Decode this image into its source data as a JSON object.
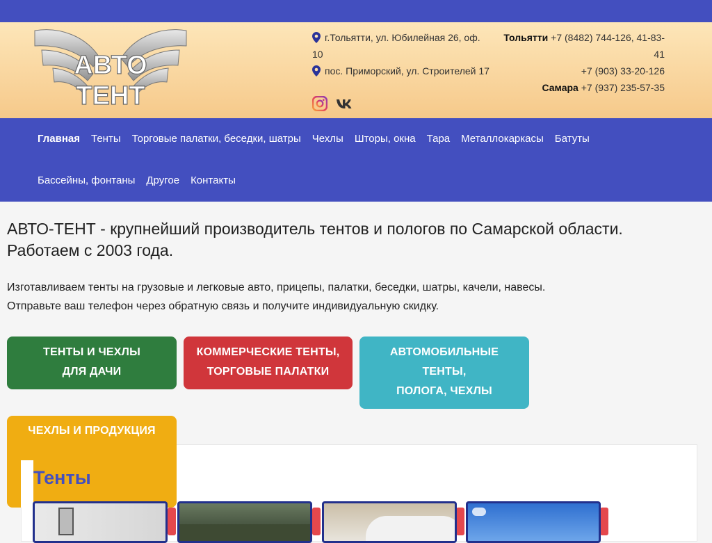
{
  "header": {
    "logo_text_top": "АВТО",
    "logo_text_bottom": "ТЕНТ",
    "address1": "г.Тольятти, ул. Юбилейная 26, оф. 10",
    "address2": "пос. Приморский, ул. Строителей 17",
    "phones": {
      "city1": "Тольятти",
      "city1_phone": "+7 (8482) 744-126, 41-83-41",
      "phone2": "+7 (903) 33-20-126",
      "city2": "Самара",
      "city2_phone": "+7 (937) 235-57-35"
    },
    "social": [
      "instagram-icon",
      "vk-icon"
    ]
  },
  "nav": {
    "items": [
      {
        "label": "Главная"
      },
      {
        "label": "Тенты"
      },
      {
        "label": "Торговые палатки, беседки, шатры"
      },
      {
        "label": "Чехлы"
      },
      {
        "label": "Шторы, окна"
      },
      {
        "label": "Тара"
      },
      {
        "label": "Металлокаркасы"
      },
      {
        "label": "Батуты"
      },
      {
        "label": "Бассейны, фонтаны"
      },
      {
        "label": "Другое"
      },
      {
        "label": "Контакты"
      }
    ]
  },
  "main": {
    "headline1": "АВТО-ТЕНТ - крупнейший производитель тентов и пологов по Самарской области.",
    "headline2": "Работаем с 2003 года.",
    "intro1": "Изготавливаем тенты на грузовые и легковые авто, прицепы, палатки, беседки, шатры, качели, навесы.",
    "intro2": "Отправьте ваш телефон через обратную связь и получите индивидуальную скидку.",
    "buttons": [
      {
        "line1": "ТЕНТЫ И ЧЕХЛЫ",
        "line2": "ДЛЯ ДАЧИ",
        "color": "#2f7d3e"
      },
      {
        "line1": "КОММЕРЧЕСКИЕ ТЕНТЫ,",
        "line2": "ТОРГОВЫЕ ПАЛАТКИ",
        "color": "#d0363b"
      },
      {
        "line1": "АВТОМОБИЛЬНЫЕ",
        "line2": "ТЕНТЫ,",
        "line3": "ПОЛОГА, ЧЕХЛЫ",
        "color": "#40b5c5"
      },
      {
        "line1": "ЧЕХЛЫ И ПРОДУКЦИЯ",
        "color": "#f0ad12"
      }
    ],
    "section_title": "Тенты"
  },
  "colors": {
    "brand_blue": "#434fbf",
    "header_top": "#fde6b9",
    "header_bottom": "#f6c98a"
  }
}
